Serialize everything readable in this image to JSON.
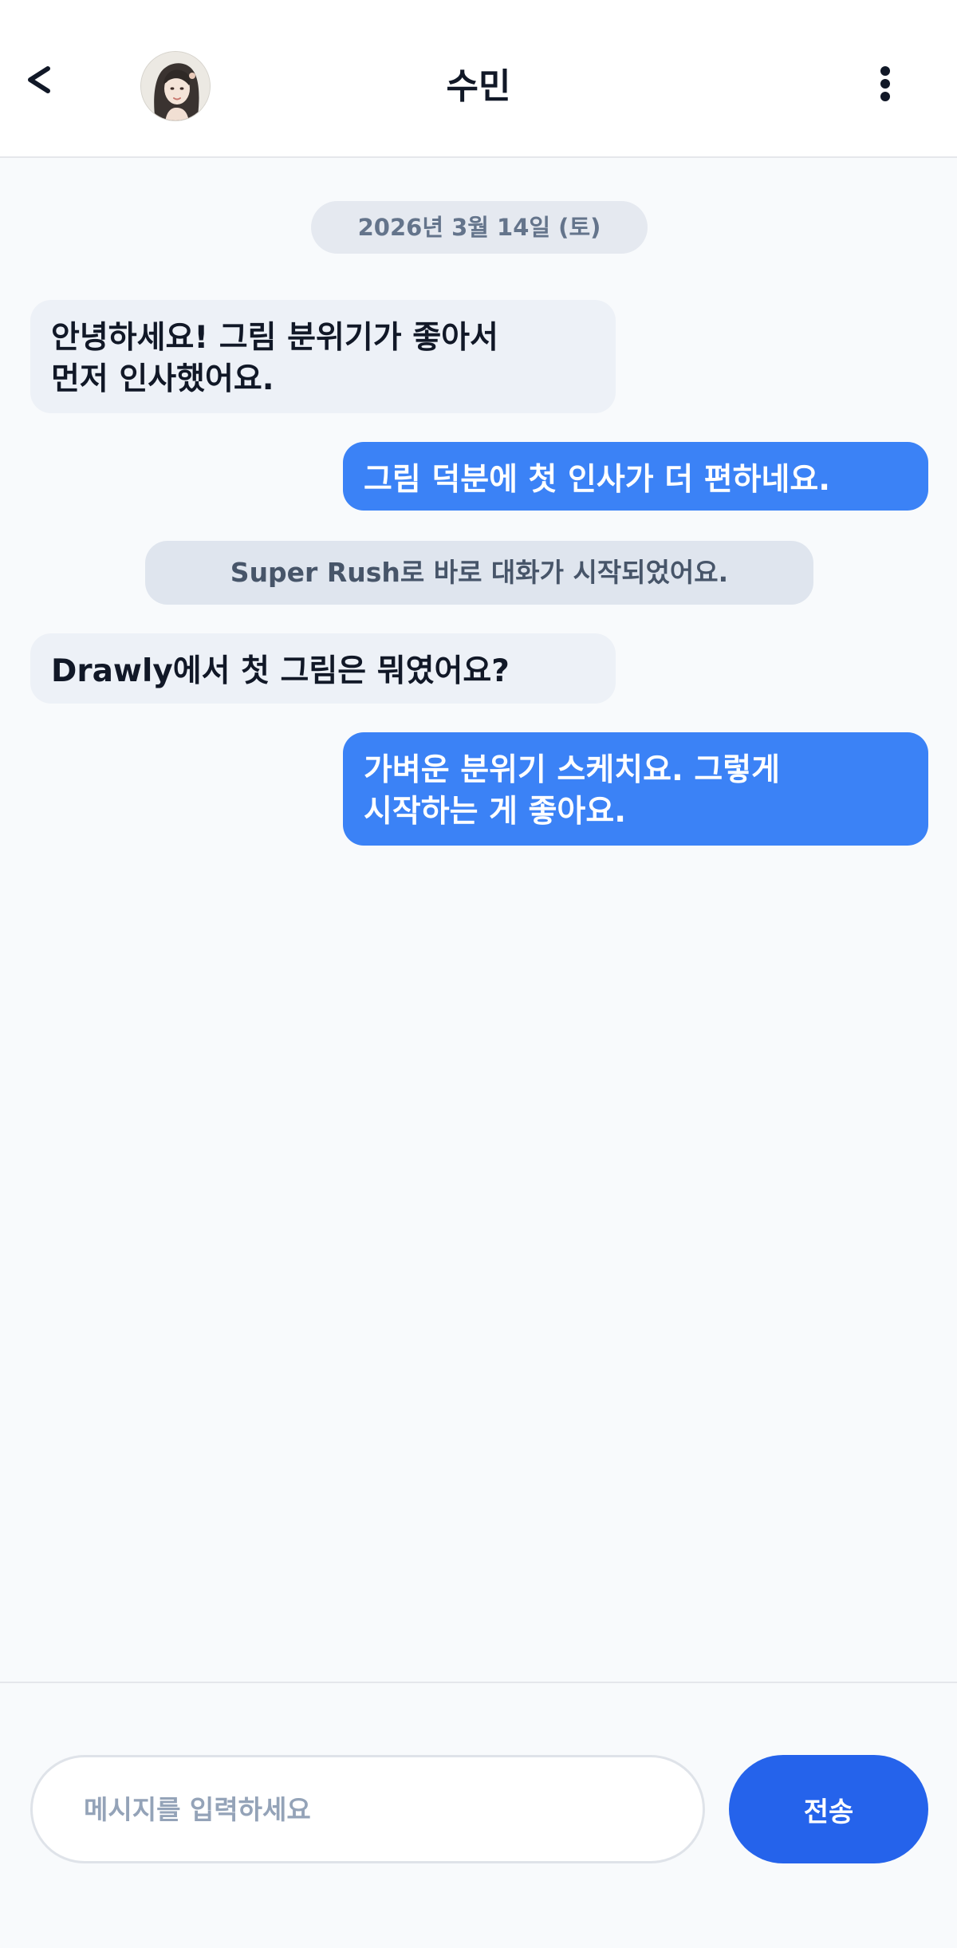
{
  "header": {
    "title": "수민",
    "back_icon": "chevron-left-icon",
    "more_icon": "more-vertical-icon",
    "avatar_alt": "수민"
  },
  "chat": {
    "date_divider": "2026년 3월 14일 (토)",
    "messages": [
      {
        "side": "in",
        "text": "안녕하세요! 그림 분위기가 좋아서\n먼저 인사했어요."
      },
      {
        "side": "out",
        "text": "그림 덕분에 첫 인사가 더 편하네요."
      },
      {
        "side": "system",
        "text": "Super Rush로 바로 대화가 시작되었어요."
      },
      {
        "side": "in",
        "text": "Drawly에서 첫 그림은 뭐였어요?"
      },
      {
        "side": "out",
        "text": "가벼운 분위기 스케치요. 그렇게\n시작하는 게 좋아요."
      }
    ]
  },
  "composer": {
    "placeholder": "메시지를 입력하세요",
    "value": "",
    "send_label": "전송"
  },
  "colors": {
    "accent": "#2563eb",
    "outgoing_bubble": "#3b82f6",
    "incoming_bubble": "#edf1f7",
    "background": "#f8fafc"
  }
}
